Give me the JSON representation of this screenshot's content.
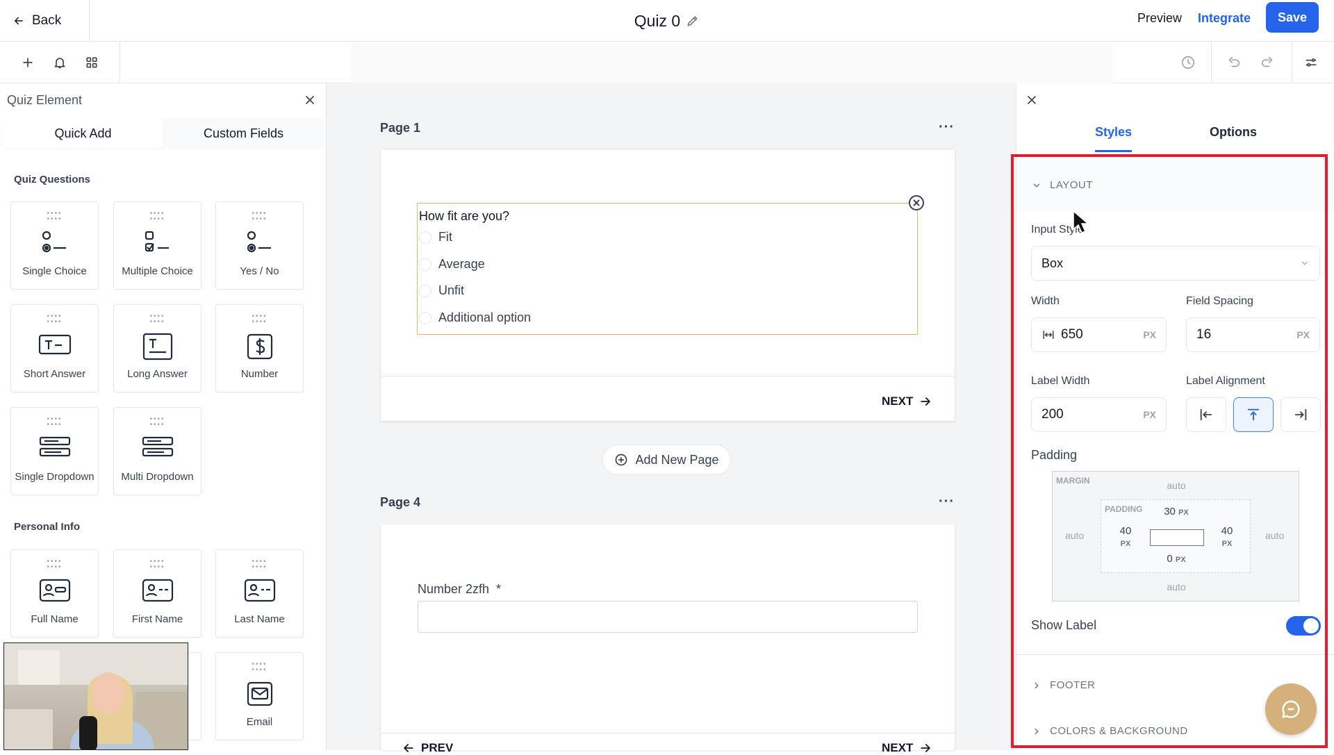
{
  "header": {
    "back_label": "Back",
    "title": "Quiz 0",
    "preview_label": "Preview",
    "integrate_label": "Integrate",
    "save_label": "Save"
  },
  "left_panel": {
    "title": "Quiz Element",
    "tabs": [
      {
        "label": "Quick Add",
        "active": true
      },
      {
        "label": "Custom Fields",
        "active": false
      }
    ],
    "sections": [
      {
        "title": "Quiz Questions",
        "items": [
          {
            "label": "Single Choice",
            "icon": "single-choice-icon"
          },
          {
            "label": "Multiple Choice",
            "icon": "multiple-choice-icon"
          },
          {
            "label": "Yes / No",
            "icon": "yes-no-icon"
          },
          {
            "label": "Short Answer",
            "icon": "short-answer-icon"
          },
          {
            "label": "Long Answer",
            "icon": "long-answer-icon"
          },
          {
            "label": "Number",
            "icon": "dollar-icon"
          },
          {
            "label": "Single Dropdown",
            "icon": "dropdown-icon"
          },
          {
            "label": "Multi Dropdown",
            "icon": "dropdown-icon"
          }
        ]
      },
      {
        "title": "Personal Info",
        "items": [
          {
            "label": "Full Name",
            "icon": "id-card-icon"
          },
          {
            "label": "First Name",
            "icon": "id-card-icon"
          },
          {
            "label": "Last Name",
            "icon": "id-card-icon"
          },
          {
            "label": "Email",
            "icon": "envelope-icon"
          }
        ]
      }
    ]
  },
  "canvas": {
    "page1": {
      "label": "Page 1",
      "question": "How fit are you?",
      "options": [
        "Fit",
        "Average",
        "Unfit",
        "Additional option"
      ],
      "next_label": "NEXT"
    },
    "add_page_label": "Add New Page",
    "page4": {
      "label": "Page 4",
      "field_label": "Number 2zfh",
      "required_mark": "*",
      "prev_label": "PREV",
      "next_label": "NEXT"
    }
  },
  "right_panel": {
    "tabs": [
      {
        "label": "Styles",
        "active": true
      },
      {
        "label": "Options",
        "active": false
      }
    ],
    "layout": {
      "section_label": "LAYOUT",
      "input_style_label": "Input Style",
      "input_style_value": "Box",
      "width_label": "Width",
      "width_value": "650",
      "field_spacing_label": "Field Spacing",
      "field_spacing_value": "16",
      "unit": "PX",
      "label_width_label": "Label Width",
      "label_width_value": "200",
      "label_alignment_label": "Label Alignment",
      "label_alignment_selected": "top",
      "padding_label": "Padding",
      "box_model": {
        "margin_label": "MARGIN",
        "margin_top": "auto",
        "margin_right": "auto",
        "margin_bottom": "auto",
        "margin_left": "auto",
        "padding_label": "PADDING",
        "padding_top": "30",
        "padding_right": "40",
        "padding_bottom": "0",
        "padding_left": "40",
        "unit": "PX"
      },
      "show_label_label": "Show Label",
      "show_label_on": true
    },
    "footer_label": "FOOTER",
    "colors_label": "COLORS & BACKGROUND"
  },
  "colors": {
    "accent": "#2563eb",
    "highlight_border": "#e11d2e",
    "selected_field_border": "#e0b567",
    "chat_button": "#d4b17a"
  }
}
